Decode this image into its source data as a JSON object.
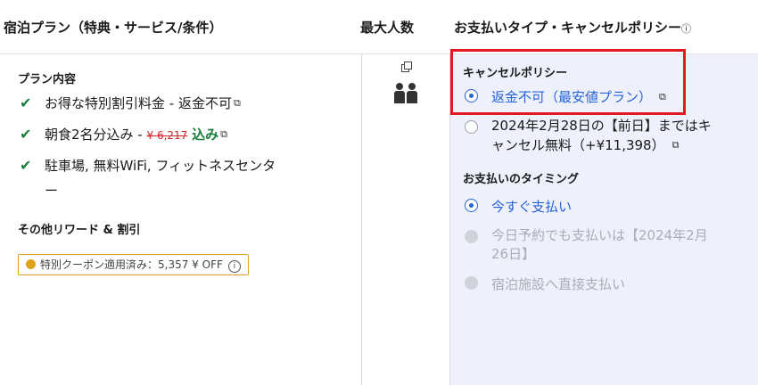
{
  "header": {
    "col_plan": "宿泊プラン（特典・サービス/条件）",
    "col_guests": "最大人数",
    "col_payment": "お支払いタイプ・キャンセルポリシー",
    "col_payment_info": "ⓘ"
  },
  "plan": {
    "section_title": "プラン内容",
    "features": [
      {
        "text": "お得な特別割引料金 - 返金不可",
        "icon": "external-link-icon"
      },
      {
        "text_prefix": "朝食2名分込み - ",
        "strike_price": "¥ 6,217",
        "included": "込み",
        "icon": "external-link-icon"
      },
      {
        "text": "駐車場, 無料WiFi, フィットネスセンタ",
        "text_cont": "ー"
      }
    ],
    "rewards_title": "その他リワード & 割引",
    "coupon": "特別クーポン適用済み：5,357 ¥ OFF",
    "coupon_info": "i"
  },
  "guests": {
    "copy_icon": "copy-icon",
    "people_icon": "two-person-icon"
  },
  "payment": {
    "cancel_title": "キャンセルポリシー",
    "cancel_options": [
      {
        "label": "返金不可（最安値プラン）",
        "state": "selected"
      },
      {
        "label_line1": "2024年2月28日の【前日】まではキ",
        "label_line2": "ャンセル無料（+¥11,398）",
        "state": "unselected"
      }
    ],
    "timing_title": "お支払いのタイミング",
    "timing_options": [
      {
        "label": "今すぐ支払い",
        "state": "selected"
      },
      {
        "label_line1": "今日予約でも支払いは【2024年2月",
        "label_line2": "26日】",
        "state": "disabled"
      },
      {
        "label": "宿泊施設へ直接支払い",
        "state": "disabled"
      }
    ]
  },
  "colors": {
    "accent_blue": "#2563d9",
    "check_green": "#1a7f3c",
    "strike_red": "#d1262b",
    "highlight_red": "#e21b23",
    "panel_bg": "#eef1fb"
  }
}
